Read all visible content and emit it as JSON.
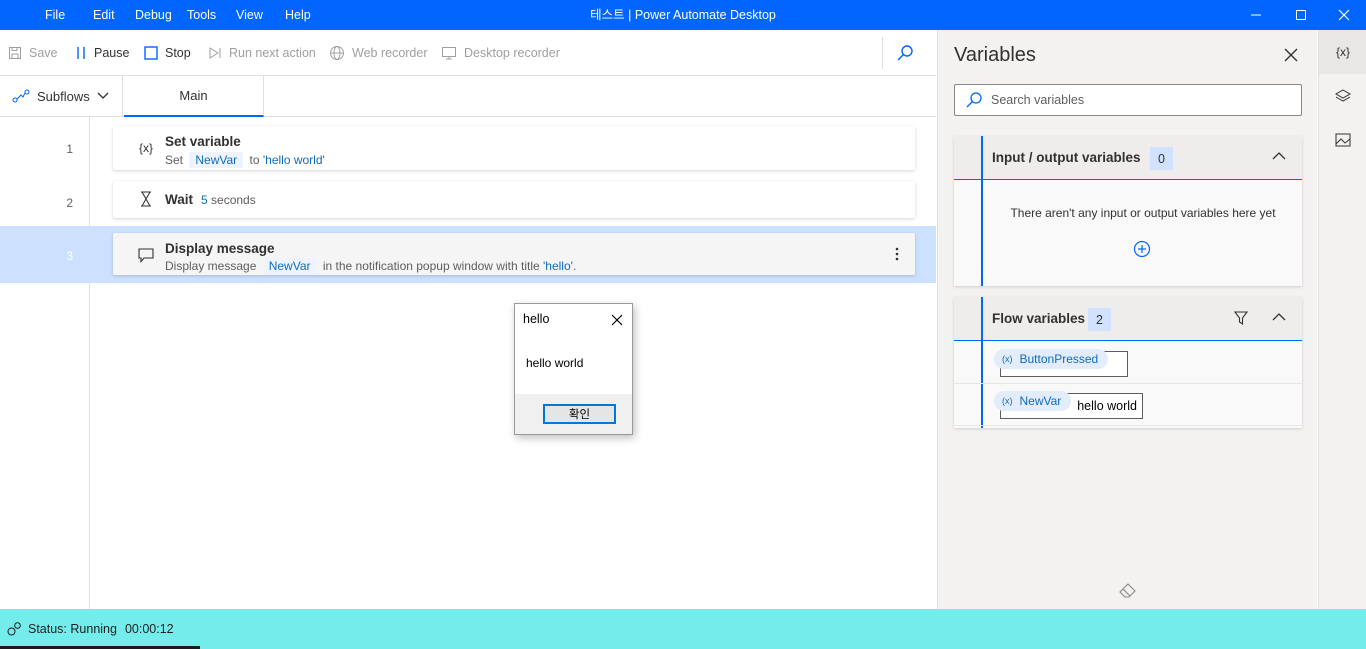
{
  "window": {
    "title": "테스트 | Power Automate Desktop",
    "menu": [
      "File",
      "Edit",
      "Debug",
      "Tools",
      "View",
      "Help"
    ]
  },
  "toolbar": {
    "save": "Save",
    "pause": "Pause",
    "stop": "Stop",
    "run_next": "Run next action",
    "web_recorder": "Web recorder",
    "desktop_recorder": "Desktop recorder"
  },
  "tabs": {
    "subflows": "Subflows",
    "main": "Main"
  },
  "actions": [
    {
      "line": "1",
      "icon_text": "{x}",
      "title": "Set variable",
      "desc_prefix": "Set",
      "var": "NewVar",
      "desc_mid": "to",
      "value": "'hello world'"
    },
    {
      "line": "2",
      "title": "Wait",
      "count": "5",
      "unit": "seconds"
    },
    {
      "line": "3",
      "title": "Display message",
      "desc_prefix": "Display message",
      "var": "NewVar",
      "desc_mid": "in the notification popup window with title",
      "value": "'hello'",
      "desc_end": "."
    }
  ],
  "popup": {
    "title": "hello",
    "message": "hello world",
    "ok": "확인"
  },
  "variables_panel": {
    "title": "Variables",
    "search_placeholder": "Search variables",
    "io_section": {
      "label": "Input / output variables",
      "count": "0",
      "empty_text": "There aren't any input or output variables here yet"
    },
    "flow_section": {
      "label": "Flow variables",
      "count": "2",
      "vars": [
        {
          "icon_text": "(x)",
          "name": "ButtonPressed",
          "value": ""
        },
        {
          "icon_text": "(x)",
          "name": "NewVar",
          "value": "hello world"
        }
      ]
    }
  },
  "rail": {
    "variables_icon_text": "{x}"
  },
  "status": {
    "label": "Status: Running",
    "time": "00:00:12"
  },
  "colors": {
    "accent": "#0066ff",
    "status_bar": "#74ecec",
    "selected_row": "#cce0ff",
    "chip_text": "#0f6cbd"
  }
}
